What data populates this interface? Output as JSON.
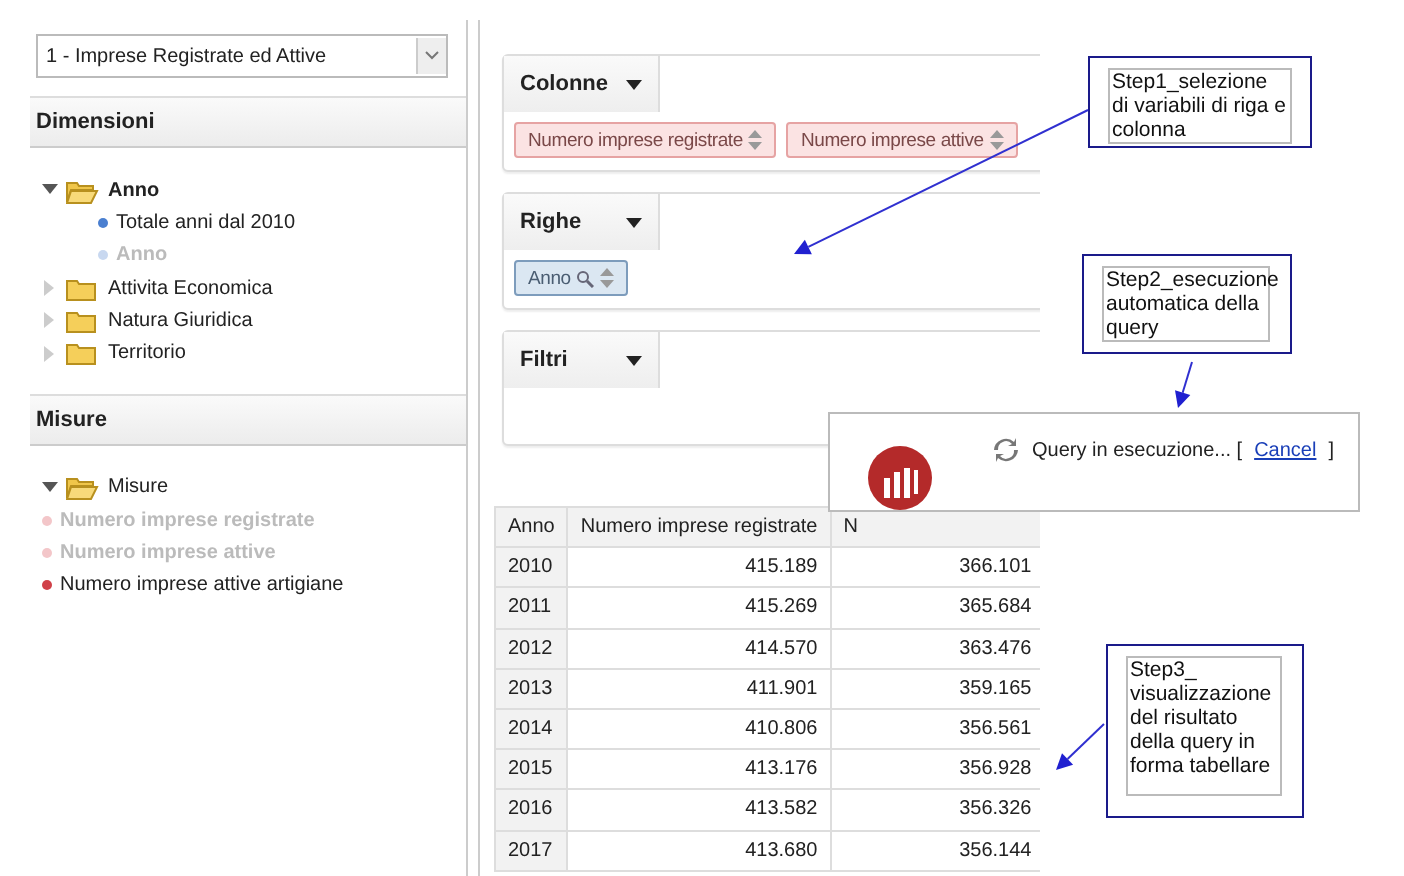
{
  "cube_select": {
    "value": "1 - Imprese Registrate ed Attive"
  },
  "dimensions": {
    "title": "Dimensioni",
    "tree": [
      {
        "label": "Anno",
        "expanded": true,
        "children": [
          {
            "label": "Totale anni dal 2010",
            "disabled": false
          },
          {
            "label": "Anno",
            "disabled": true
          }
        ]
      },
      {
        "label": "Attivita Economica",
        "expanded": false
      },
      {
        "label": "Natura Giuridica",
        "expanded": false
      },
      {
        "label": "Territorio",
        "expanded": false
      }
    ]
  },
  "measures": {
    "title": "Misure",
    "tree": [
      {
        "label": "Misure",
        "expanded": true,
        "children": [
          {
            "label": "Numero imprese registrate",
            "disabled": true
          },
          {
            "label": "Numero imprese attive",
            "disabled": true
          },
          {
            "label": "Numero imprese attive artigiane",
            "disabled": false
          }
        ]
      }
    ]
  },
  "shelves": [
    {
      "title": "Colonne",
      "chips": [
        {
          "label": "Numero imprese registrate",
          "kind": "measure"
        },
        {
          "label": "Numero imprese attive",
          "kind": "measure"
        }
      ]
    },
    {
      "title": "Righe",
      "chips": [
        {
          "label": "Anno",
          "kind": "dimension"
        }
      ]
    },
    {
      "title": "Filtri"
    }
  ],
  "table": {
    "columns": [
      "Anno",
      "Numero imprese registrate",
      "N"
    ],
    "rows": [
      [
        "2010",
        "415.189",
        "366.101"
      ],
      [
        "2011",
        "415.269",
        "365.684"
      ],
      [
        "2012",
        "414.570",
        "363.476"
      ],
      [
        "2013",
        "411.901",
        "359.165"
      ],
      [
        "2014",
        "410.806",
        "356.561"
      ],
      [
        "2015",
        "413.176",
        "356.928"
      ],
      [
        "2016",
        "413.582",
        "356.326"
      ],
      [
        "2017",
        "413.680",
        "356.144"
      ]
    ]
  },
  "query_popup": {
    "message": "Query in esecuzione... [",
    "link": "Cancel",
    "closing": "]"
  },
  "callouts": [
    {
      "text": "Step1_selezione di variabili di riga e colonna"
    },
    {
      "text": "Step2_esecuzione automatica della query"
    },
    {
      "text": "Step3_ visualizzazione del risultato della query in forma tabellare"
    }
  ]
}
